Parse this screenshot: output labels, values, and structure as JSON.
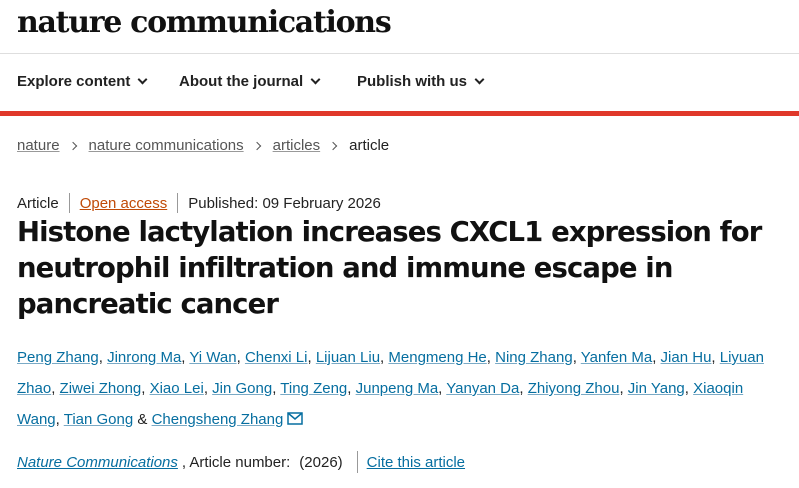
{
  "header": {
    "logo_text": "nature communications"
  },
  "nav": {
    "items": [
      {
        "label": "Explore content"
      },
      {
        "label": "About the journal"
      },
      {
        "label": "Publish with us"
      }
    ]
  },
  "breadcrumb": {
    "items": [
      {
        "label": "nature"
      },
      {
        "label": "nature communications"
      },
      {
        "label": "articles"
      }
    ],
    "current": "article"
  },
  "article": {
    "type": "Article",
    "access": "Open access",
    "published": "Published: 09 February 2026",
    "title": "Histone lactylation increases CXCL1 expression for neutrophil infiltration and immune escape in pancreatic cancer",
    "authors": [
      "Peng Zhang",
      "Jinrong Ma",
      "Yi Wan",
      "Chenxi Li",
      "Lijuan Liu",
      "Mengmeng He",
      "Ning Zhang",
      "Yanfen Ma",
      "Jian Hu",
      "Liyuan Zhao",
      "Ziwei Zhong",
      "Xiao Lei",
      "Jin Gong",
      "Ting Zeng",
      "Junpeng Ma",
      "Yanyan Da",
      "Zhiyong Zhou",
      "Jin Yang",
      "Xiaoqin Wang",
      "Tian Gong",
      "Chengsheng Zhang"
    ],
    "journal": "Nature Communications",
    "article_number_label": ", Article number:",
    "year": "(2026)",
    "cite_label": "Cite this article"
  },
  "colors": {
    "accent_red": "#e0382a",
    "link_blue": "#066ea0",
    "open_access": "#c04a07"
  }
}
